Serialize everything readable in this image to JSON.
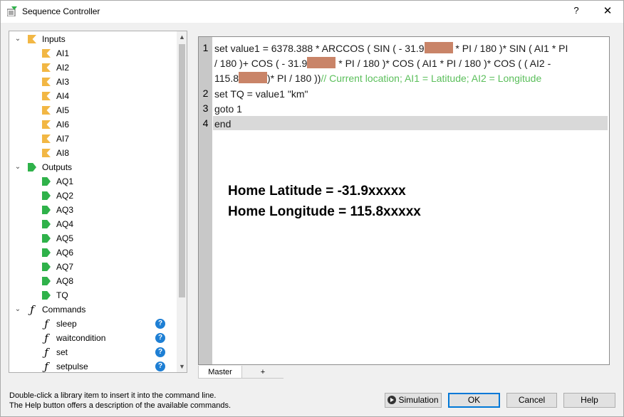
{
  "window": {
    "title": "Sequence Controller",
    "help_glyph": "?",
    "close_glyph": "✕"
  },
  "tree": {
    "groups": [
      {
        "label": "Inputs",
        "icon": "input-arrow-icon",
        "items": [
          "AI1",
          "AI2",
          "AI3",
          "AI4",
          "AI5",
          "AI6",
          "AI7",
          "AI8"
        ]
      },
      {
        "label": "Outputs",
        "icon": "output-arrow-icon",
        "items": [
          "AQ1",
          "AQ2",
          "AQ3",
          "AQ4",
          "AQ5",
          "AQ6",
          "AQ7",
          "AQ8",
          "TQ"
        ]
      },
      {
        "label": "Commands",
        "icon": "function-icon",
        "items": [
          "sleep",
          "waitcondition",
          "set",
          "setpulse"
        ]
      }
    ],
    "function_glyph": "ƒ",
    "help_glyph": "?",
    "chevron_glyph": "⌄"
  },
  "editor": {
    "line_numbers": [
      "1",
      "2",
      "3",
      "4"
    ],
    "line1_part1": "set value1 = 6378.388 * ARCCOS ( SIN (  - 31.9",
    "line1_part2": " * PI / 180 )* SIN ( AI1 * PI",
    "line1_part3": "/ 180 )+ COS ( - 31.9",
    "line1_part4": " * PI / 180 )* COS ( AI1 * PI / 180 )* COS ( (  AI2 -",
    "line1_part5": "115.8",
    "line1_part6": ")* PI / 180 ))",
    "line1_comment": "// Current location; AI1 = Latitude; AI2 = Longitude",
    "line2": "set TQ = value1 \"km\"",
    "line3": "goto 1",
    "line4": "end",
    "home_latitude": "Home Latitude = -31.9xxxxx",
    "home_longitude": "Home Longitude = 115.8xxxxx"
  },
  "tabs": {
    "master": "Master",
    "add": "+"
  },
  "hint": {
    "line1": "Double-click a library item to insert it into the command line.",
    "line2": "The Help button offers a description of the available commands."
  },
  "buttons": {
    "simulation": "Simulation",
    "ok": "OK",
    "cancel": "Cancel",
    "help": "Help"
  },
  "colors": {
    "input_icon": "#f2b744",
    "output_icon": "#2fb24a",
    "comment": "#5bbf5b",
    "redaction": "#c98468",
    "help_icon": "#1e7fd4"
  }
}
